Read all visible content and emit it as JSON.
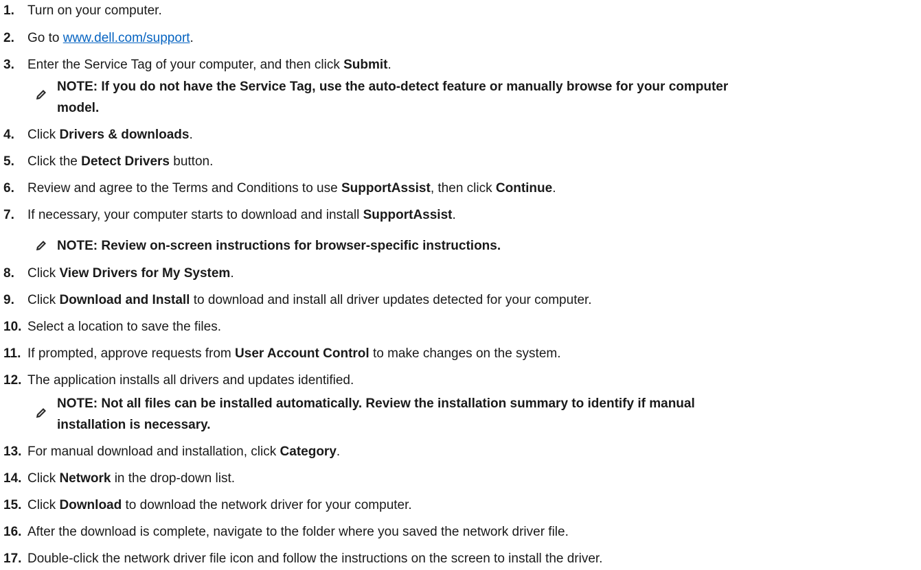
{
  "steps": [
    {
      "num": "1.",
      "parts": [
        "Turn on your computer."
      ]
    },
    {
      "num": "2.",
      "pre": "Go to ",
      "link": "www.dell.com/support",
      "post": "."
    },
    {
      "num": "3.",
      "parts": [
        "Enter the Service Tag of your computer, and then click ",
        "Submit",
        "."
      ]
    },
    {
      "num": "4.",
      "parts": [
        "Click ",
        "Drivers & downloads",
        "."
      ]
    },
    {
      "num": "5.",
      "parts": [
        "Click the ",
        "Detect Drivers",
        " button."
      ]
    },
    {
      "num": "6.",
      "parts": [
        "Review and agree to the Terms and Conditions to use ",
        "SupportAssist",
        ", then click ",
        "Continue",
        "."
      ]
    },
    {
      "num": "7.",
      "parts": [
        "If necessary, your computer starts to download and install ",
        "SupportAssist",
        "."
      ]
    },
    {
      "num": "8.",
      "parts": [
        "Click ",
        "View Drivers for My System",
        "."
      ]
    },
    {
      "num": "9.",
      "parts": [
        "Click ",
        "Download and Install",
        " to download and install all driver updates detected for your computer."
      ]
    },
    {
      "num": "10.",
      "parts": [
        "Select a location to save the files."
      ]
    },
    {
      "num": "11.",
      "parts": [
        "If prompted, approve requests from ",
        "User Account Control",
        " to make changes on the system."
      ]
    },
    {
      "num": "12.",
      "parts": [
        "The application installs all drivers and updates identified."
      ]
    },
    {
      "num": "13.",
      "parts": [
        "For manual download and installation, click ",
        "Category",
        "."
      ]
    },
    {
      "num": "14.",
      "parts": [
        "Click ",
        "Network",
        " in the drop-down list."
      ]
    },
    {
      "num": "15.",
      "parts": [
        "Click ",
        "Download",
        " to download the network driver for your computer."
      ]
    },
    {
      "num": "16.",
      "parts": [
        "After the download is complete, navigate to the folder where you saved the network driver file."
      ]
    },
    {
      "num": "17.",
      "parts": [
        "Double-click the network driver file icon and follow the instructions on the screen to install the driver."
      ]
    }
  ],
  "notes": [
    {
      "line1": "NOTE: If you do not have the Service Tag, use the auto-detect feature or manually browse for your computer",
      "line2": "model."
    },
    {
      "line1": "NOTE: Review on-screen instructions for browser-specific instructions."
    },
    {
      "line1": "NOTE: Not all files can be installed automatically. Review the installation summary to identify if manual",
      "line2": "installation is necessary."
    }
  ],
  "note_icon": "pencil-note-icon",
  "colors": {
    "text": "#1a1a1a",
    "link": "#0563c1"
  }
}
